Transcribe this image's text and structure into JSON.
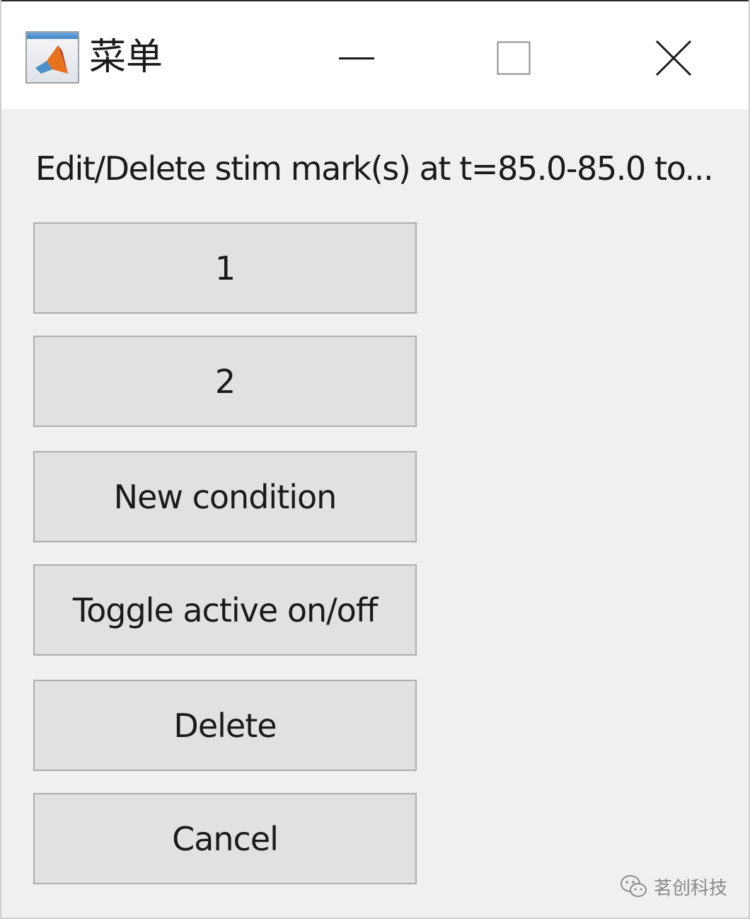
{
  "window": {
    "title": "菜单",
    "app_icon": "matlab-logo-icon",
    "controls": {
      "minimize_icon": "minimize-icon",
      "maximize_icon": "maximize-icon",
      "close_icon": "close-icon"
    }
  },
  "prompt": "Edit/Delete stim mark(s) at t=85.0-85.0 to...",
  "buttons": [
    {
      "label": "1"
    },
    {
      "label": "2"
    },
    {
      "label": "New condition"
    },
    {
      "label": "Toggle active on/off"
    },
    {
      "label": "Delete"
    },
    {
      "label": "Cancel"
    }
  ],
  "watermark": {
    "icon": "wechat-icon",
    "text": "茗创科技"
  },
  "colors": {
    "dialog_bg": "#f0f0f0",
    "titlebar_bg": "#ffffff",
    "button_bg": "#e1e1e1",
    "button_border": "#adadad",
    "text": "#1a1a1a"
  }
}
